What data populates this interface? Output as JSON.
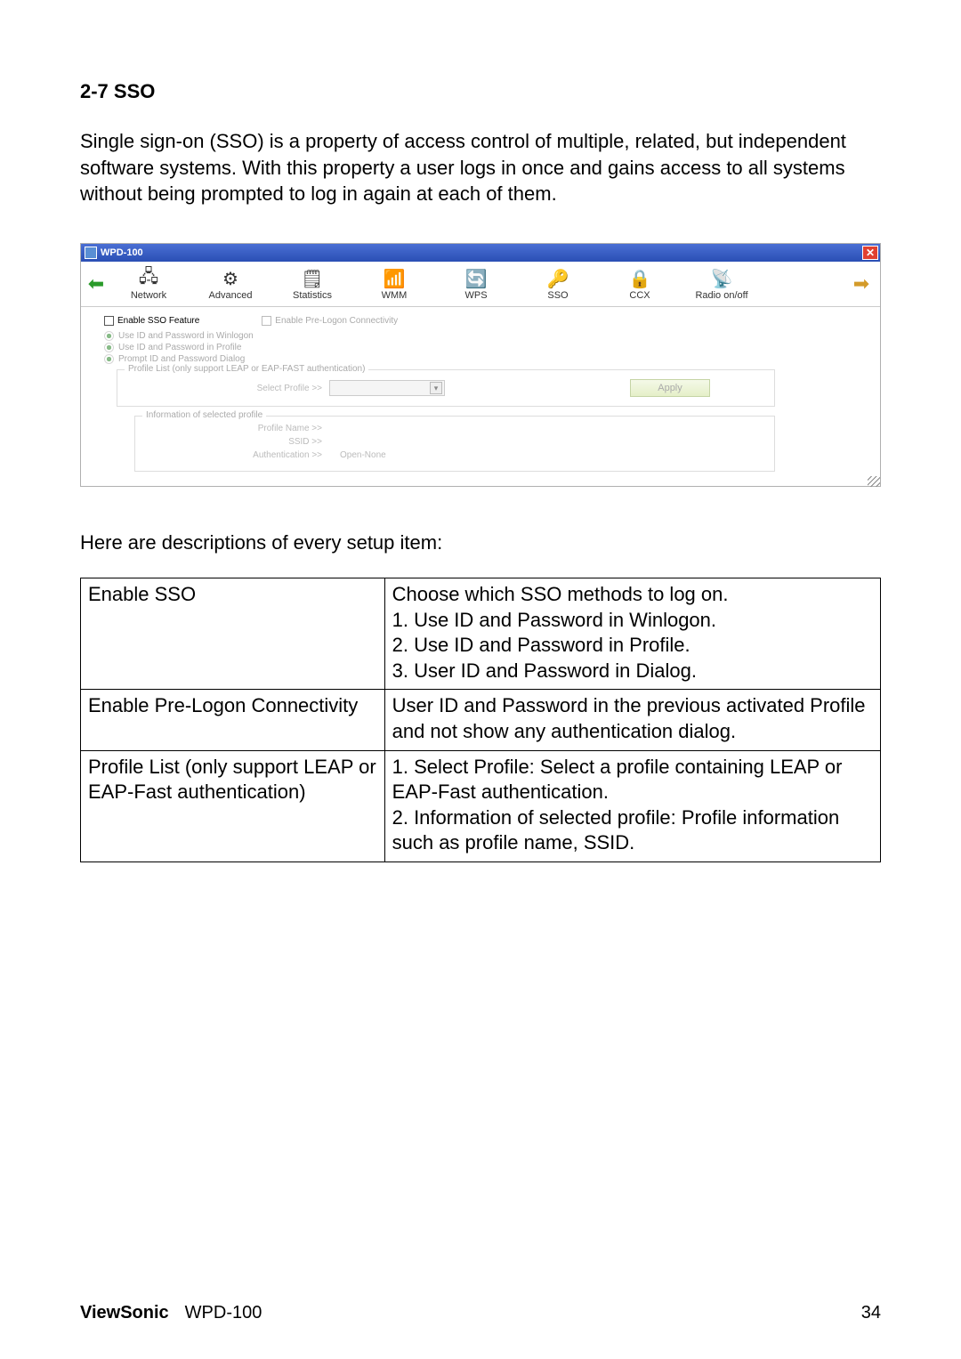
{
  "section": {
    "heading": "2-7 SSO"
  },
  "intro_paragraph": "Single sign-on (SSO) is a property of access control of multiple, related, but independent software systems. With this property a user logs in once and gains access to all systems without being prompted to log in again at each of them.",
  "window": {
    "title": "WPD-100",
    "toolbar": [
      {
        "label": "Network"
      },
      {
        "label": "Advanced"
      },
      {
        "label": "Statistics"
      },
      {
        "label": "WMM"
      },
      {
        "label": "WPS"
      },
      {
        "label": "SSO"
      },
      {
        "label": "CCX"
      },
      {
        "label": "Radio on/off"
      }
    ],
    "checks": {
      "enable_sso": "Enable SSO Feature",
      "enable_prelogon": "Enable Pre-Logon Connectivity"
    },
    "radios": [
      "Use ID and Password in Winlogon",
      "Use ID and Password in Profile",
      "Prompt ID and Password Dialog"
    ],
    "profile_list_legend": "Profile List (only support LEAP or EAP-FAST authentication)",
    "select_profile_label": "Select Profile >>",
    "apply_label": "Apply",
    "info_legend": "Information of selected profile",
    "info": {
      "profile_name_label": "Profile Name >>",
      "ssid_label": "SSID >>",
      "auth_label": "Authentication >>",
      "auth_value": "Open-None"
    }
  },
  "desc_intro": "Here are descriptions of every setup item:",
  "table": {
    "r1c1": "Enable SSO",
    "r1c2": "Choose which SSO methods to log on.\n1. Use ID and Password in Winlogon.\n2.  Use ID and Password in Profile.\n3.  User ID and Password in Dialog.",
    "r2c1": "Enable Pre-Logon Connectivity",
    "r2c2": "User ID and Password in the previous activated Profile and not show any authentication dialog.",
    "r3c1": "Profile List (only support LEAP or EAP-Fast authentication)",
    "r3c2": "1.  Select Profile: Select a profile containing LEAP or EAP-Fast authentication.\n2.  Information of selected profile: Profile information such as profile name, SSID."
  },
  "footer": {
    "brand": "ViewSonic",
    "model": "WPD-100",
    "page": "34"
  }
}
